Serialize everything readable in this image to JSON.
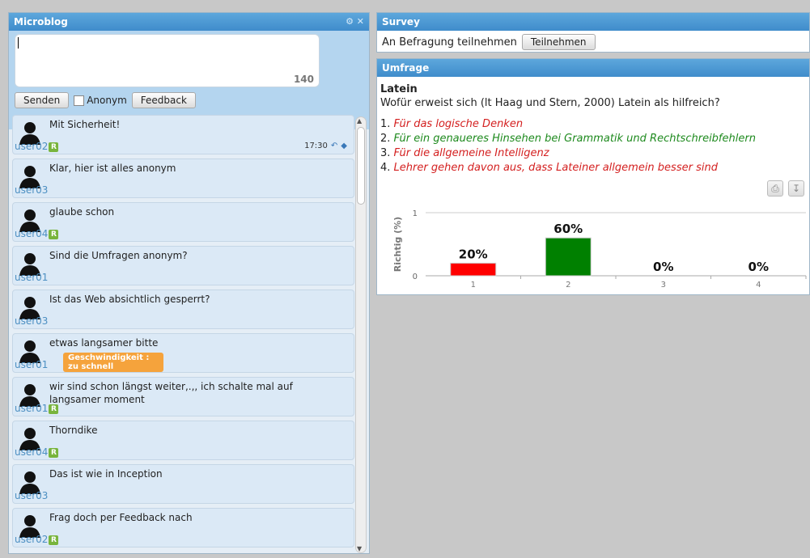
{
  "microblog": {
    "title": "Microblog",
    "counter": "140",
    "send_label": "Senden",
    "anon_label": "Anonym",
    "feedback_label": "Feedback",
    "posts": [
      {
        "text": "Mit Sicherheit!",
        "user": "user02",
        "badge": "R",
        "time": "17:30"
      },
      {
        "text": "Klar, hier ist alles anonym",
        "user": "user03"
      },
      {
        "text": "glaube schon",
        "user": "user04",
        "badge": "R"
      },
      {
        "text": "Sind die Umfragen anonym?",
        "user": "user01"
      },
      {
        "text": "Ist das Web absichtlich gesperrt?",
        "user": "user03"
      },
      {
        "text": "etwas langsamer bitte",
        "user": "user01",
        "tag": "Geschwindigkeit : zu schnell"
      },
      {
        "text": "wir sind schon längst weiter,.,, ich schalte mal auf langsamer moment",
        "user": "user01",
        "badge": "R"
      },
      {
        "text": "Thorndike",
        "user": "user04",
        "badge": "R"
      },
      {
        "text": "Das ist wie in Inception",
        "user": "user03"
      },
      {
        "text": "Frag doch per Feedback nach",
        "user": "user02",
        "badge": "R"
      }
    ]
  },
  "survey": {
    "title": "Survey",
    "prompt": "An Befragung teilnehmen",
    "button": "Teilnehmen"
  },
  "umfrage": {
    "title": "Umfrage",
    "heading": "Latein",
    "question": "Wofür erweist sich (lt Haag und Stern, 2000) Latein als hilfreich?",
    "answers": [
      {
        "num": "1.",
        "text": "Für das logische Denken",
        "color": "#d42020"
      },
      {
        "num": "2.",
        "text": "Für ein genaueres Hinsehen bei Grammatik und Rechtschreibfehlern",
        "color": "#1e8a1e"
      },
      {
        "num": "3.",
        "text": "Für die allgemeine Intelligenz",
        "color": "#d42020"
      },
      {
        "num": "4.",
        "text": "Lehrer gehen davon aus, dass Lateiner allgemein besser sind",
        "color": "#d42020"
      }
    ]
  },
  "chart_data": {
    "type": "bar",
    "categories": [
      "1",
      "2",
      "3",
      "4"
    ],
    "values": [
      0.2,
      0.6,
      0,
      0
    ],
    "labels": [
      "20%",
      "60%",
      "0%",
      "0%"
    ],
    "colors": [
      "#ff0000",
      "#008000",
      "#ff0000",
      "#ff0000"
    ],
    "ylabel": "Richtig (%)",
    "ylim": [
      0,
      1
    ],
    "yticks": [
      "0",
      "1"
    ]
  }
}
